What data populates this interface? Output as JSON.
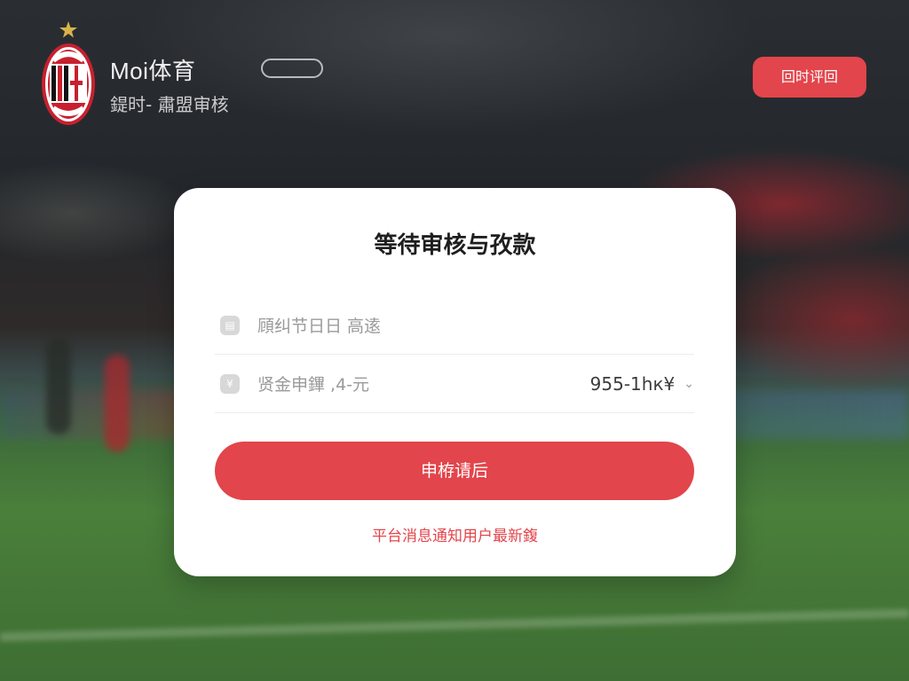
{
  "header": {
    "brand_title": "Moi体育",
    "brand_badge": "",
    "brand_subtitle": "鍉时- 肅盟审核",
    "top_button_label": "回时评回"
  },
  "card": {
    "title": "等待审核与孜款",
    "rows": [
      {
        "icon": "id-card-icon",
        "text": "頋纠节日日 高逺",
        "value": ""
      },
      {
        "icon": "money-bag-icon",
        "text": "贤金申鏎 ,4-元",
        "value": "955-1hк¥"
      }
    ],
    "button_label": "申栫请后",
    "notice": "平台消息通知用户最新鍑"
  },
  "colors": {
    "accent": "#e2454b",
    "card_bg": "#ffffff",
    "logo_red": "#c8202f",
    "logo_black": "#111111",
    "logo_star": "#d9b24a"
  }
}
